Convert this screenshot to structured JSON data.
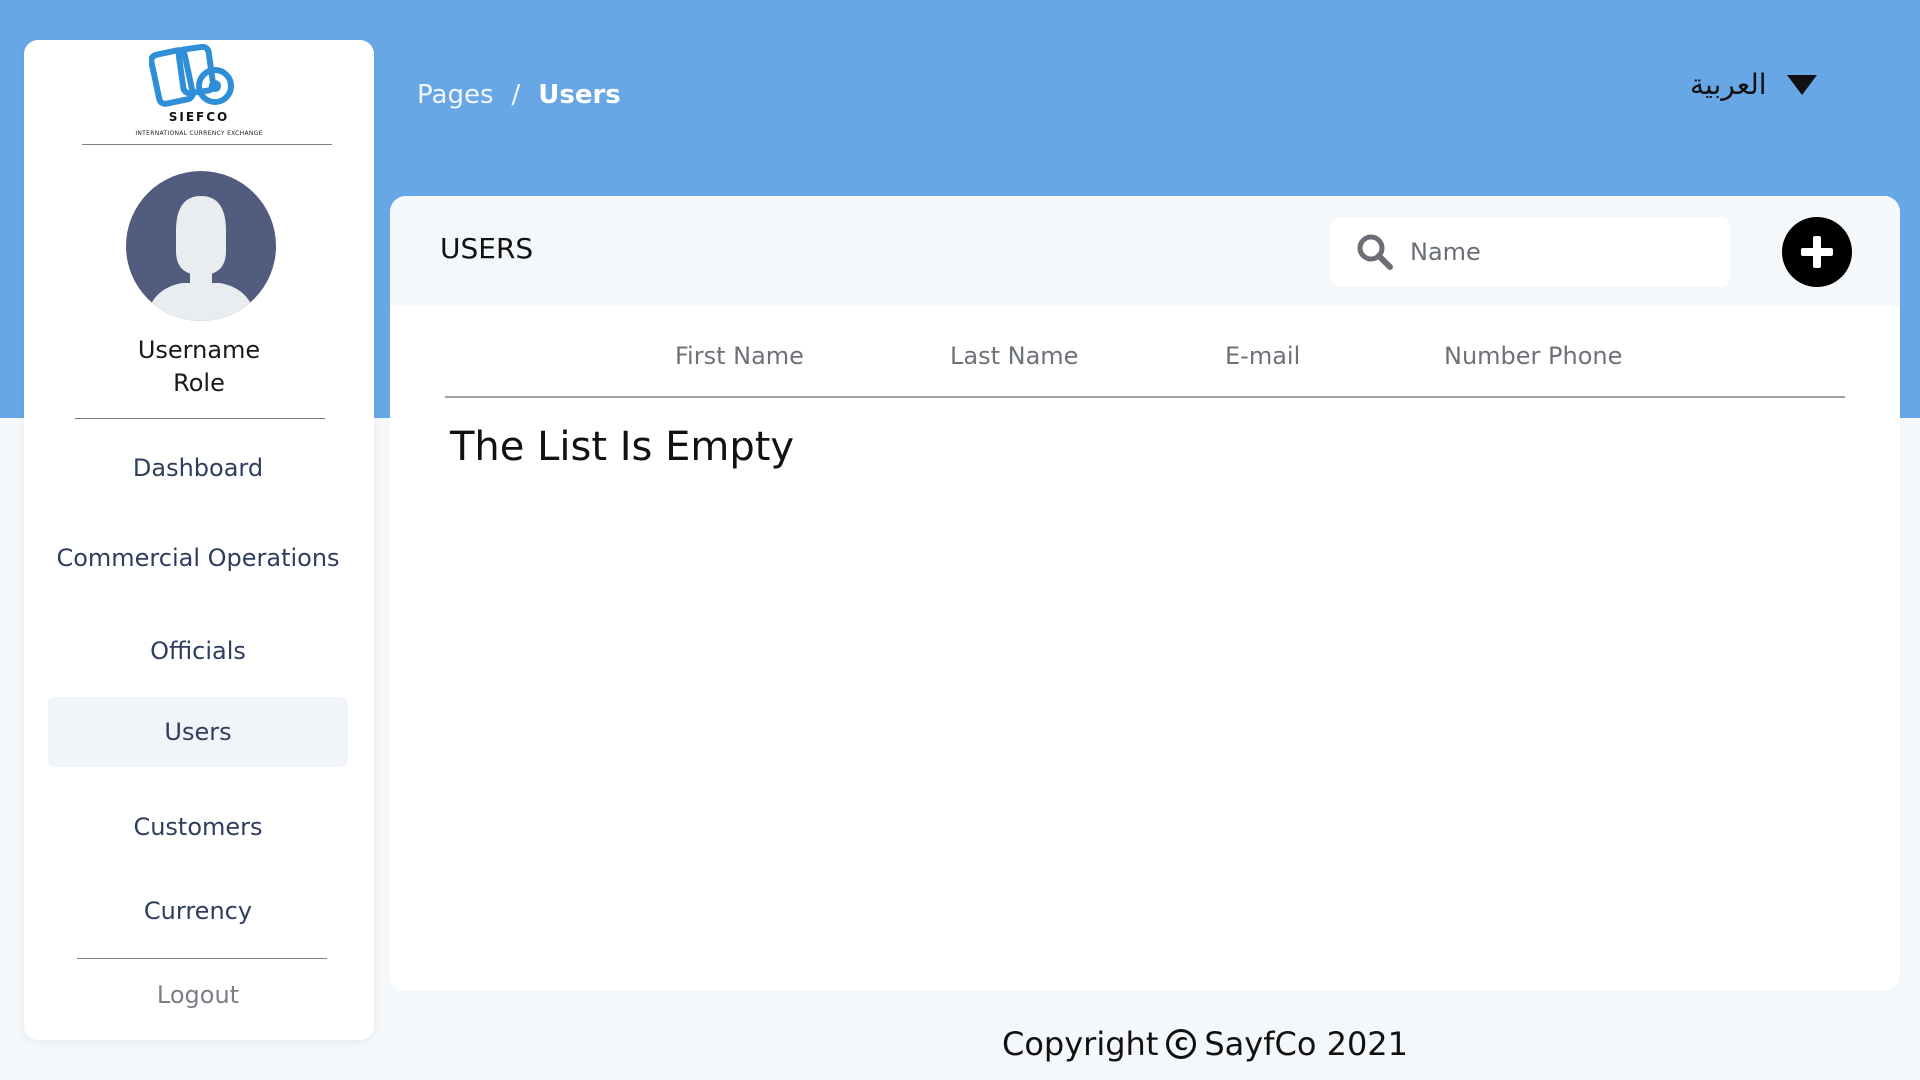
{
  "brand": {
    "name": "SIEFCO",
    "tagline": "INTERNATIONAL CURRENCY EXCHANGE"
  },
  "user": {
    "name": "Username",
    "role": "Role"
  },
  "sidebar": {
    "items": [
      {
        "label": "Dashboard"
      },
      {
        "label": "Commercial Operations"
      },
      {
        "label": "Officials"
      },
      {
        "label": "Users"
      },
      {
        "label": "Customers"
      },
      {
        "label": "Currency"
      }
    ],
    "logout": "Logout"
  },
  "header": {
    "breadcrumb": {
      "root": "Pages",
      "separator": "/",
      "current": "Users"
    },
    "language": "العربية"
  },
  "main": {
    "title": "USERS",
    "search": {
      "placeholder": "Name",
      "value": ""
    },
    "columns": [
      "First Name",
      "Last Name",
      "E-mail",
      "Number Phone"
    ],
    "empty_message": "The List Is Empty"
  },
  "footer": {
    "prefix": "Copyright",
    "symbol": "C",
    "text": "SayfCo 2021"
  },
  "colors": {
    "header_band": "#68a7e5",
    "avatar_bg": "#525c7e",
    "logo_blue": "#2e8fd8"
  },
  "icons": {
    "search": "search-icon",
    "add": "plus-icon",
    "dropdown": "triangle-down-icon",
    "avatar": "user-silhouette-icon"
  }
}
